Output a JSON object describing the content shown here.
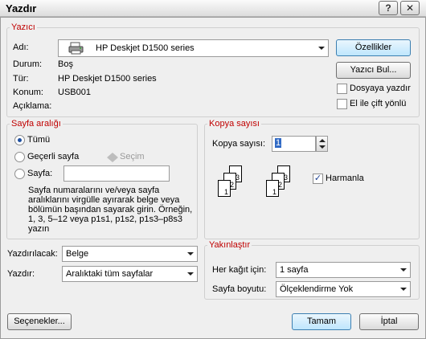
{
  "window": {
    "title": "Yazdır",
    "help_button": "?",
    "close_button": "✕"
  },
  "printer": {
    "legend": "Yazıcı",
    "name_label": "Adı:",
    "name_value": "HP Deskjet D1500 series",
    "status_label": "Durum:",
    "status_value": "Boş",
    "type_label": "Tür:",
    "type_value": "HP Deskjet D1500 series",
    "location_label": "Konum:",
    "location_value": "USB001",
    "comment_label": "Açıklama:",
    "comment_value": "",
    "properties_button": "Özellikler",
    "find_printer_button": "Yazıcı Bul...",
    "print_to_file_label": "Dosyaya yazdır",
    "print_to_file_checked": false,
    "manual_duplex_label": "El ile çift yönlü",
    "manual_duplex_checked": false
  },
  "page_range": {
    "legend": "Sayfa aralığı",
    "all_label": "Tümü",
    "current_page_label": "Geçerli sayfa",
    "selection_label": "Seçim",
    "pages_label": "Sayfa:",
    "pages_value": "",
    "selected": "all",
    "help_text": [
      "Sayfa numaralarını ve/veya sayfa",
      "aralıklarını virgülle ayırarak belge veya",
      "bölümün başından sayarak girin. Örneğin,",
      "1, 3, 5–12 veya p1s1, p1s2, p1s3–p8s3",
      "yazın"
    ]
  },
  "copies": {
    "legend": "Kopya sayısı",
    "count_label": "Kopya sayısı:",
    "count_value": "1",
    "collate_label": "Harmanla",
    "collate_checked": true
  },
  "print_what": {
    "label": "Yazdırılacak:",
    "value": "Belge"
  },
  "print_range": {
    "label": "Yazdır:",
    "value": "Aralıktaki tüm sayfalar"
  },
  "zoom": {
    "legend": "Yakınlaştır",
    "pages_per_sheet_label": "Her kağıt için:",
    "pages_per_sheet_value": "1 sayfa",
    "scale_label": "Sayfa boyutu:",
    "scale_value": "Ölçeklendirme Yok"
  },
  "footer": {
    "options_button": "Seçenekler...",
    "ok_button": "Tamam",
    "cancel_button": "İptal"
  }
}
